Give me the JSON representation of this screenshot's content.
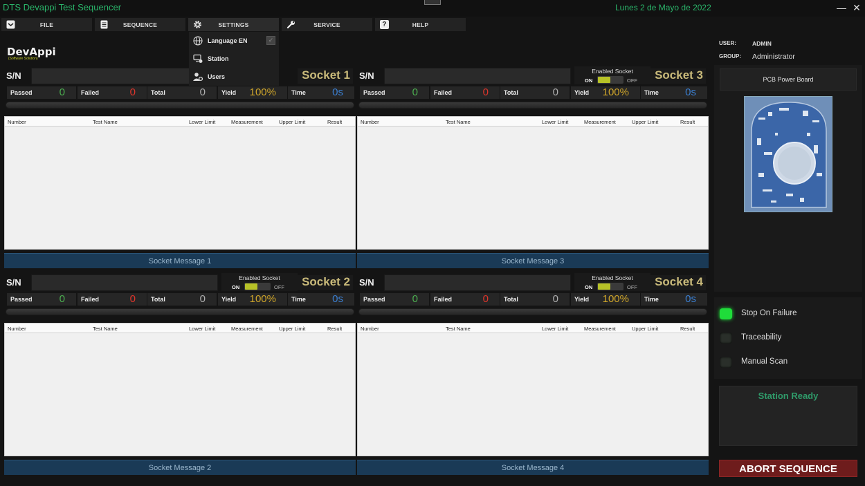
{
  "window": {
    "title": "DTS Devappi Test Sequencer",
    "date": "Lunes 2 de Mayo de 2022",
    "minimize_glyph": "—",
    "close_glyph": "✕"
  },
  "menu": {
    "file": "FILE",
    "sequence": "SEQUENCE",
    "settings": "SETTINGS",
    "service": "SERVICE",
    "help": "HELP",
    "help_glyph": "?"
  },
  "settings_menu": {
    "language": "Language EN",
    "station": "Station",
    "users": "Users",
    "check_glyph": "✓"
  },
  "logo": {
    "main": "DevAppi",
    "sub": "(Software Solution)"
  },
  "table_headers": [
    "Number",
    "Test Name",
    "Lower Limit",
    "Measurement",
    "Upper Limit",
    "Result"
  ],
  "stat_labels": {
    "passed": "Passed",
    "failed": "Failed",
    "total": "Total",
    "yield": "Yield",
    "time": "Time"
  },
  "enable_labels": {
    "title": "Enabled Socket",
    "on": "ON",
    "off": "OFF"
  },
  "sn_label": "S/N",
  "sockets": [
    {
      "name": "Socket 1",
      "passed": "0",
      "failed": "0",
      "total": "0",
      "yield": "100%",
      "time": "0s",
      "message": "Socket Message 1",
      "enabled": true
    },
    {
      "name": "Socket 3",
      "passed": "0",
      "failed": "0",
      "total": "0",
      "yield": "100%",
      "time": "0s",
      "message": "Socket Message 3",
      "enabled": true
    },
    {
      "name": "Socket 2",
      "passed": "0",
      "failed": "0",
      "total": "0",
      "yield": "100%",
      "time": "0s",
      "message": "Socket Message 2",
      "enabled": true
    },
    {
      "name": "Socket 4",
      "passed": "0",
      "failed": "0",
      "total": "0",
      "yield": "100%",
      "time": "0s",
      "message": "Socket Message 4",
      "enabled": true
    }
  ],
  "user": {
    "user_key": "USER:",
    "user_val": "ADMIN",
    "group_key": "GROUP:",
    "group_val": "Administrator"
  },
  "product": {
    "name": "PCB Power Board"
  },
  "options": [
    {
      "label": "Stop On Failure",
      "state": "on",
      "color": "#1fdc3a"
    },
    {
      "label": "Traceability",
      "state": "off",
      "color": "#2a2f2a"
    },
    {
      "label": "Manual Scan",
      "state": "off",
      "color": "#2a2f2a"
    }
  ],
  "status": "Station Ready",
  "abort": "ABORT SEQUENCE",
  "colors": {
    "passed": "#4caf50",
    "failed": "#e0352b",
    "total": "#b0b0b0",
    "yield": "#d0a62a",
    "time": "#3b7fd1",
    "accent": "#2ab56a"
  }
}
